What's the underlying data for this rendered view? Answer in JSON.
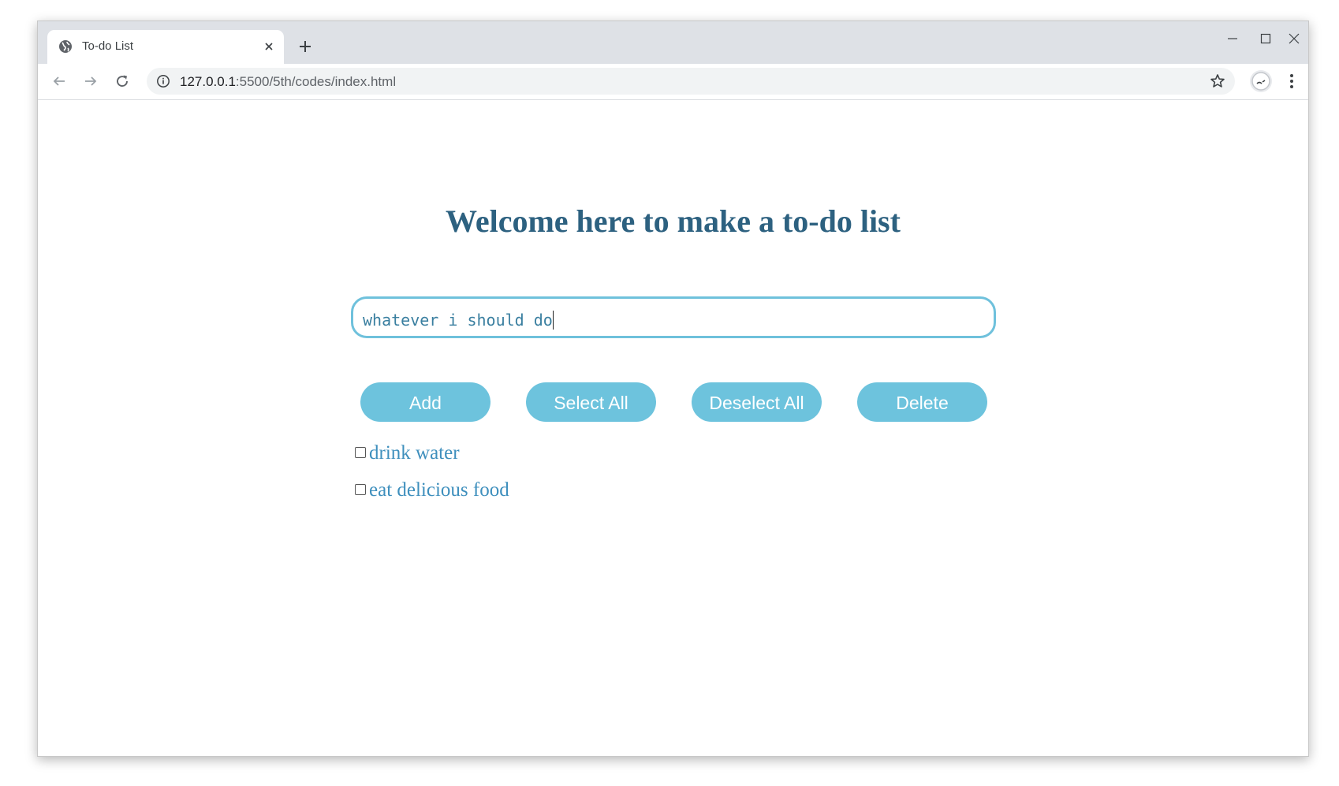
{
  "browser": {
    "tab": {
      "title": "To-do List"
    },
    "address_bar": {
      "url_host": "127.0.0.1",
      "url_rest": ":5500/5th/codes/index.html"
    }
  },
  "page": {
    "heading": "Welcome here to make a to-do list",
    "input": {
      "value": "whatever i should do"
    },
    "buttons": {
      "add": "Add",
      "select_all": "Select All",
      "deselect_all": "Deselect All",
      "delete": "Delete"
    },
    "todos": [
      {
        "label": "drink water",
        "checked": false
      },
      {
        "label": "eat delicious food",
        "checked": false
      }
    ]
  },
  "colors": {
    "heading": "#2d6180",
    "button_bg": "#6dc3dd",
    "input_border": "#6fc1dc",
    "item_text": "#3e8fbd"
  }
}
